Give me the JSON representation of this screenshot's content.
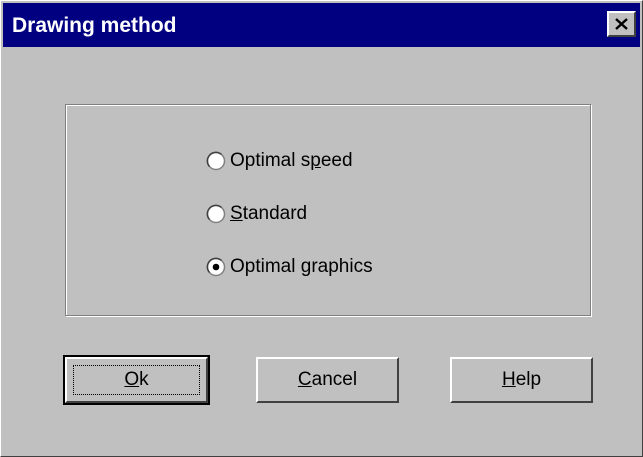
{
  "window": {
    "title": "Drawing method"
  },
  "titlebar": {
    "close_icon": "close-icon"
  },
  "options": [
    {
      "label_before": "Optimal s",
      "accel": "p",
      "label_after": "eed",
      "selected": false
    },
    {
      "label_before": "",
      "accel": "S",
      "label_after": "tandard",
      "selected": false
    },
    {
      "label_before": "Optimal ",
      "accel": "g",
      "label_after": "raphics",
      "selected": true
    }
  ],
  "buttons": {
    "ok": {
      "accel": "O",
      "rest": "k"
    },
    "cancel": {
      "accel": "C",
      "rest": "ancel"
    },
    "help": {
      "accel": "H",
      "rest": "elp"
    }
  },
  "colors": {
    "titlebar": "#000080",
    "face": "#c0c0c0"
  }
}
